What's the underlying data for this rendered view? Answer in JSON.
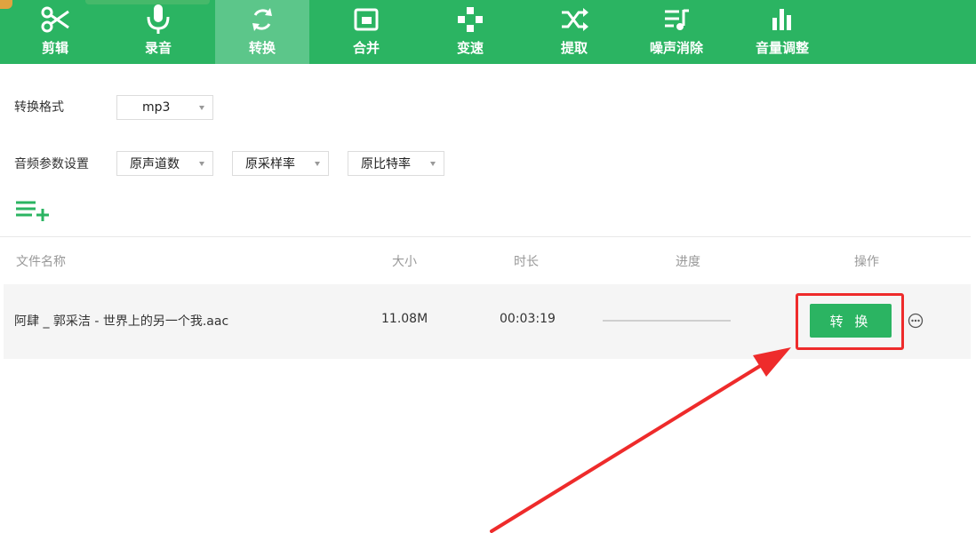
{
  "toolbar": {
    "items": [
      {
        "label": "剪辑",
        "icon": "scissors-icon"
      },
      {
        "label": "录音",
        "icon": "microphone-icon"
      },
      {
        "label": "转换",
        "icon": "convert-icon",
        "active": true
      },
      {
        "label": "合并",
        "icon": "merge-icon"
      },
      {
        "label": "变速",
        "icon": "speed-icon"
      },
      {
        "label": "提取",
        "icon": "extract-icon"
      },
      {
        "label": "噪声消除",
        "icon": "noise-removal-icon"
      },
      {
        "label": "音量调整",
        "icon": "volume-adjust-icon"
      }
    ]
  },
  "settings": {
    "format_label": "转换格式",
    "format_value": "mp3",
    "audio_params_label": "音频参数设置",
    "channel_value": "原声道数",
    "sample_rate_value": "原采样率",
    "bitrate_value": "原比特率"
  },
  "table": {
    "headers": {
      "name": "文件名称",
      "size": "大小",
      "duration": "时长",
      "progress": "进度",
      "action": "操作"
    },
    "rows": [
      {
        "name": "阿肆 _ 郭采洁 - 世界上的另一个我.aac",
        "size": "11.08M",
        "duration": "00:03:19",
        "progress": 0,
        "action_label": "转 换"
      }
    ]
  },
  "colors": {
    "brand": "#2bb462",
    "highlight": "#ee2b2b"
  }
}
